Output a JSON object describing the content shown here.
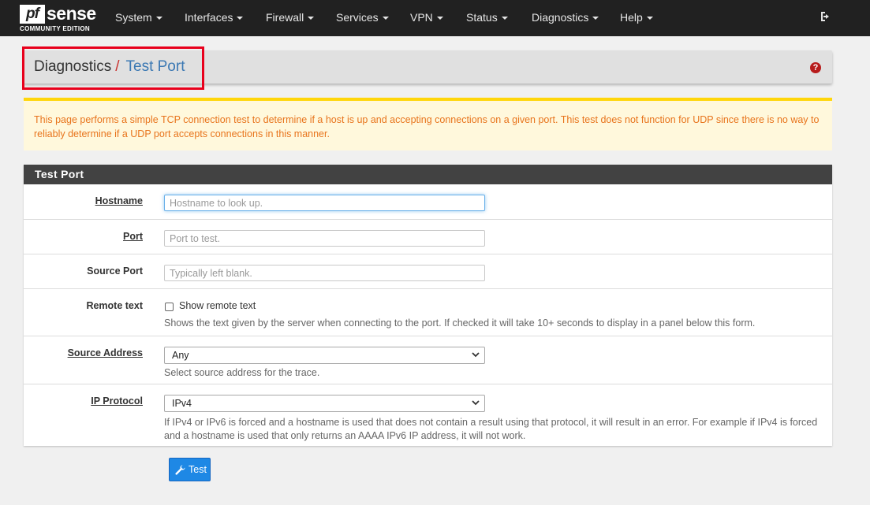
{
  "brand": {
    "logo_pf": "pf",
    "logo_sense": "sense",
    "logo_edition": "COMMUNITY EDITION"
  },
  "nav": {
    "items": [
      "System",
      "Interfaces",
      "Firewall",
      "Services",
      "VPN",
      "Status",
      "Diagnostics",
      "Help"
    ],
    "logout_icon": "sign-out-icon"
  },
  "breadcrumb": {
    "parent": "Diagnostics",
    "separator": "/",
    "current": "Test Port",
    "help_icon": "question-circle-icon",
    "help_glyph": "?"
  },
  "alert": {
    "text": "This page performs a simple TCP connection test to determine if a host is up and accepting connections on a given port. This test does not function for UDP since there is no way to reliably determine if a UDP port accepts connections in this manner."
  },
  "panel": {
    "title": "Test Port",
    "hostname": {
      "label": "Hostname",
      "placeholder": "Hostname to look up.",
      "value": ""
    },
    "port": {
      "label": "Port",
      "placeholder": "Port to test.",
      "value": ""
    },
    "source_port": {
      "label": "Source Port",
      "placeholder": "Typically left blank.",
      "value": ""
    },
    "remote_text": {
      "label": "Remote text",
      "checkbox_label": "Show remote text",
      "checked": false,
      "help": "Shows the text given by the server when connecting to the port. If checked it will take 10+ seconds to display in a panel below this form."
    },
    "source_address": {
      "label": "Source Address",
      "selected": "Any",
      "help": "Select source address for the trace."
    },
    "ip_protocol": {
      "label": "IP Protocol",
      "selected": "IPv4",
      "help_line1": "If IPv4 or IPv6 is forced and a hostname is used that does not contain a result using that protocol, it will result in an error. For example if IPv4 is forced",
      "help_line2": "and a hostname is used that only returns an AAAA IPv6 IP address, it will not work."
    }
  },
  "actions": {
    "test_label": "Test",
    "test_icon": "wrench-icon"
  },
  "colors": {
    "navbar": "#212121",
    "accent_red": "#c9302c",
    "link_blue": "#3b78b3",
    "alert_text": "#e8741c",
    "alert_border": "#ffd60a",
    "button": "#1e88e5"
  }
}
